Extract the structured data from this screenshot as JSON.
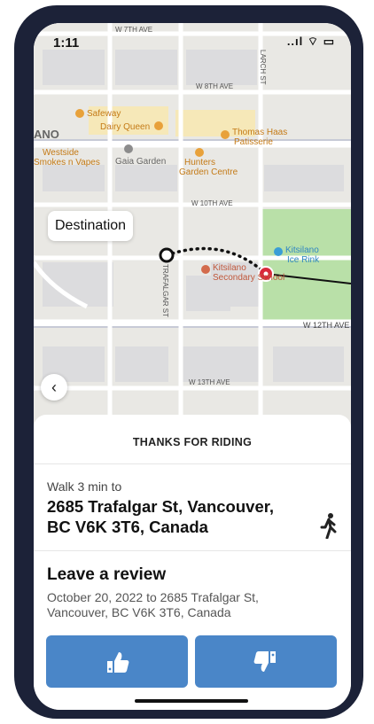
{
  "status_bar": {
    "time": "1:11",
    "signal_text": "..ıl  ⌔  ▭"
  },
  "map": {
    "streets": [
      "W 7TH AVE",
      "W 8TH AVE",
      "W 10TH AVE",
      "W 12TH AVE",
      "W 13TH AVE",
      "TRAFALGAR ST",
      "LARCH ST"
    ],
    "places": [
      "Safeway",
      "Dairy Queen",
      "Thomas Haas",
      "Patisserie",
      "ANO",
      "Westside",
      "Smokes n Vapes",
      "Gaia Garden",
      "Hunters",
      "Garden Centre",
      "Kitsilano",
      "Ice Rink",
      "Kitsilano",
      "Secondary School"
    ],
    "destination_label": "Destination"
  },
  "sheet": {
    "title": "THANKS FOR RIDING",
    "walk_label": "Walk 3 min to",
    "address": "2685 Trafalgar St, Vancouver, BC V6K 3T6, Canada",
    "review_title": "Leave a review",
    "review_subtitle": "October 20, 2022 to 2685 Trafalgar St, Vancouver, BC V6K 3T6, Canada"
  },
  "icons": {
    "back": "chevron-left-icon",
    "walk": "walking-person-icon",
    "like": "thumbs-up-icon",
    "dislike": "thumbs-down-icon"
  },
  "colors": {
    "accent": "#4a86c8",
    "route_end": "#d9293a",
    "frame": "#1c2238"
  }
}
